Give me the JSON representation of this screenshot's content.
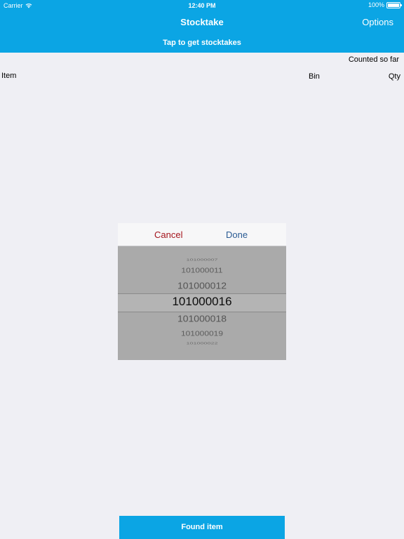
{
  "status_bar": {
    "carrier": "Carrier",
    "time": "12:40 PM",
    "battery": "100%",
    "battery_level": 1.0
  },
  "nav": {
    "title": "Stocktake",
    "options_label": "Options"
  },
  "subheader": {
    "label": "Tap to get stocktakes"
  },
  "list": {
    "counted_label": "Counted so far",
    "col_item": "Item",
    "col_bin": "Bin",
    "col_qty": "Qty"
  },
  "picker": {
    "cancel_label": "Cancel",
    "done_label": "Done",
    "items": [
      "101000007",
      "101000011",
      "101000012",
      "101000016",
      "101000018",
      "101000019",
      "101000022"
    ],
    "selected": "101000016"
  },
  "footer": {
    "found_item_label": "Found item"
  },
  "colors": {
    "accent": "#0ba5e4",
    "cancel": "#a4141c",
    "done": "#2a5b93"
  }
}
